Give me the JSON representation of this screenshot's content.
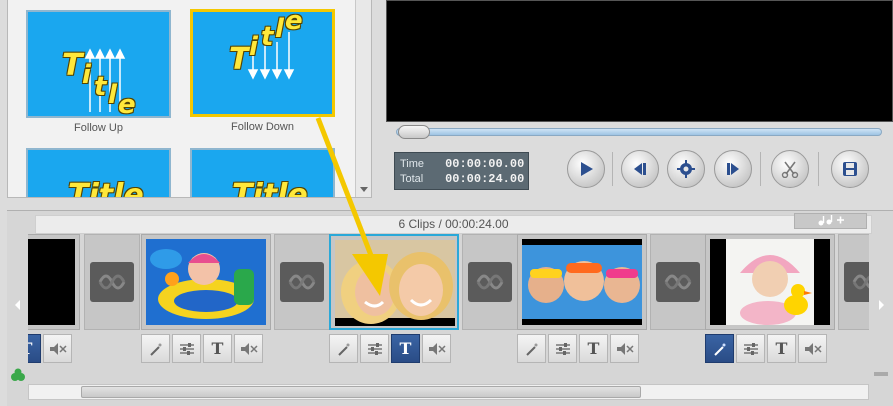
{
  "effects": {
    "items": [
      {
        "label": "Follow Up",
        "title_text": "Title"
      },
      {
        "label": "Follow Down",
        "title_text": "Title"
      },
      {
        "label": "",
        "title_text": "Title"
      },
      {
        "label": "",
        "title_text": "Title"
      }
    ]
  },
  "player": {
    "time_label": "Time",
    "time_value": "00:00:00.00",
    "total_label": "Total",
    "total_value": "00:00:24.00",
    "seek_progress": 0.0
  },
  "timeline": {
    "summary": "6 Clips / 00:00:24.00",
    "tool_text": "T",
    "mute_text": "◀×"
  },
  "colors": {
    "accent_selected": "#f4c800",
    "clip_selected": "#2aa8d8",
    "tool_active": "#2f579a"
  }
}
